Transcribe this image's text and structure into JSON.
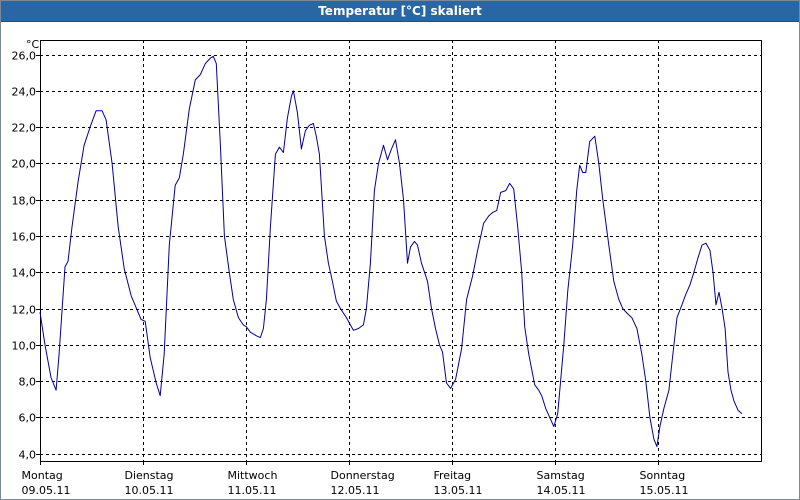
{
  "window": {
    "title": "Temperatur [°C] skaliert"
  },
  "chart_data": {
    "type": "line",
    "title": "Temperatur [°C] skaliert",
    "ylabel": "°C",
    "xlabel": "",
    "ylim": [
      3.6,
      26.8
    ],
    "yticks": [
      "4,0",
      "6,0",
      "8,0",
      "10,0",
      "12,0",
      "14,0",
      "16,0",
      "18,0",
      "20,0",
      "22,0",
      "24,0",
      "26,0"
    ],
    "ytick_values": [
      4,
      6,
      8,
      10,
      12,
      14,
      16,
      18,
      20,
      22,
      24,
      26
    ],
    "xlim": [
      0,
      7
    ],
    "x_unit": "days since Montag 09.05.11 00:00",
    "xticks": [
      {
        "day": "Montag",
        "date": "09.05.11"
      },
      {
        "day": "Dienstag",
        "date": "10.05.11"
      },
      {
        "day": "Mittwoch",
        "date": "11.05.11"
      },
      {
        "day": "Donnerstag",
        "date": "12.05.11"
      },
      {
        "day": "Freitag",
        "date": "13.05.11"
      },
      {
        "day": "Samstag",
        "date": "14.05.11"
      },
      {
        "day": "Sonntag",
        "date": "15.05.11"
      }
    ],
    "grid": true,
    "line_color": "#0000a0",
    "series": [
      {
        "points": [
          [
            0.0,
            11.8
          ],
          [
            0.049,
            10.0
          ],
          [
            0.107,
            8.2
          ],
          [
            0.156,
            7.5
          ],
          [
            0.185,
            9.5
          ],
          [
            0.243,
            14.3
          ],
          [
            0.272,
            14.6
          ],
          [
            0.311,
            16.5
          ],
          [
            0.37,
            19.0
          ],
          [
            0.428,
            21.0
          ],
          [
            0.486,
            22.0
          ],
          [
            0.545,
            22.9
          ],
          [
            0.603,
            22.9
          ],
          [
            0.642,
            22.4
          ],
          [
            0.7,
            20.0
          ],
          [
            0.759,
            16.5
          ],
          [
            0.817,
            14.2
          ],
          [
            0.885,
            12.7
          ],
          [
            0.982,
            11.4
          ],
          [
            1.021,
            11.3
          ],
          [
            1.07,
            9.3
          ],
          [
            1.128,
            7.9
          ],
          [
            1.167,
            7.2
          ],
          [
            1.206,
            9.5
          ],
          [
            1.255,
            15.5
          ],
          [
            1.313,
            18.8
          ],
          [
            1.352,
            19.2
          ],
          [
            1.391,
            20.5
          ],
          [
            1.45,
            23.0
          ],
          [
            1.508,
            24.6
          ],
          [
            1.557,
            24.9
          ],
          [
            1.605,
            25.5
          ],
          [
            1.654,
            25.8
          ],
          [
            1.683,
            25.9
          ],
          [
            1.712,
            25.5
          ],
          [
            1.751,
            21.0
          ],
          [
            1.79,
            16.0
          ],
          [
            1.838,
            14.0
          ],
          [
            1.877,
            12.5
          ],
          [
            1.926,
            11.5
          ],
          [
            1.974,
            11.1
          ],
          [
            2.003,
            11.0
          ],
          [
            2.042,
            10.7
          ],
          [
            2.101,
            10.5
          ],
          [
            2.14,
            10.4
          ],
          [
            2.169,
            10.9
          ],
          [
            2.198,
            12.5
          ],
          [
            2.237,
            16.5
          ],
          [
            2.285,
            20.5
          ],
          [
            2.324,
            20.9
          ],
          [
            2.363,
            20.6
          ],
          [
            2.402,
            22.5
          ],
          [
            2.441,
            23.7
          ],
          [
            2.46,
            24.0
          ],
          [
            2.499,
            22.8
          ],
          [
            2.538,
            20.8
          ],
          [
            2.577,
            21.8
          ],
          [
            2.615,
            22.1
          ],
          [
            2.654,
            22.2
          ],
          [
            2.683,
            21.5
          ],
          [
            2.713,
            20.5
          ],
          [
            2.761,
            16.0
          ],
          [
            2.8,
            14.5
          ],
          [
            2.839,
            13.5
          ],
          [
            2.878,
            12.4
          ],
          [
            2.917,
            12.0
          ],
          [
            2.975,
            11.5
          ],
          [
            3.004,
            11.2
          ],
          [
            3.043,
            10.8
          ],
          [
            3.092,
            10.9
          ],
          [
            3.14,
            11.1
          ],
          [
            3.169,
            12.0
          ],
          [
            3.208,
            14.5
          ],
          [
            3.247,
            18.5
          ],
          [
            3.286,
            20.0
          ],
          [
            3.335,
            21.0
          ],
          [
            3.374,
            20.2
          ],
          [
            3.413,
            20.8
          ],
          [
            3.451,
            21.3
          ],
          [
            3.49,
            20.0
          ],
          [
            3.529,
            18.0
          ],
          [
            3.568,
            14.5
          ],
          [
            3.597,
            15.4
          ],
          [
            3.636,
            15.7
          ],
          [
            3.665,
            15.5
          ],
          [
            3.704,
            14.5
          ],
          [
            3.762,
            13.5
          ],
          [
            3.801,
            12.0
          ],
          [
            3.84,
            10.9
          ],
          [
            3.879,
            10.0
          ],
          [
            3.908,
            9.6
          ],
          [
            3.947,
            7.9
          ],
          [
            3.986,
            7.6
          ],
          [
            4.035,
            8.1
          ],
          [
            4.093,
            9.8
          ],
          [
            4.142,
            12.5
          ],
          [
            4.2,
            13.8
          ],
          [
            4.249,
            15.2
          ],
          [
            4.307,
            16.7
          ],
          [
            4.356,
            17.1
          ],
          [
            4.395,
            17.3
          ],
          [
            4.434,
            17.4
          ],
          [
            4.473,
            18.4
          ],
          [
            4.521,
            18.5
          ],
          [
            4.56,
            18.9
          ],
          [
            4.599,
            18.6
          ],
          [
            4.638,
            16.5
          ],
          [
            4.677,
            14.0
          ],
          [
            4.706,
            11.0
          ],
          [
            4.745,
            9.5
          ],
          [
            4.803,
            7.8
          ],
          [
            4.842,
            7.5
          ],
          [
            4.871,
            7.2
          ],
          [
            4.91,
            6.5
          ],
          [
            4.949,
            6.0
          ],
          [
            4.988,
            5.5
          ],
          [
            5.026,
            6.2
          ],
          [
            5.085,
            10.0
          ],
          [
            5.124,
            13.0
          ],
          [
            5.172,
            15.5
          ],
          [
            5.211,
            18.5
          ],
          [
            5.24,
            19.9
          ],
          [
            5.269,
            19.5
          ],
          [
            5.299,
            19.5
          ],
          [
            5.337,
            21.2
          ],
          [
            5.386,
            21.5
          ],
          [
            5.425,
            20.0
          ],
          [
            5.464,
            18.0
          ],
          [
            5.522,
            15.5
          ],
          [
            5.571,
            13.5
          ],
          [
            5.619,
            12.5
          ],
          [
            5.658,
            12.0
          ],
          [
            5.707,
            11.7
          ],
          [
            5.746,
            11.5
          ],
          [
            5.795,
            10.9
          ],
          [
            5.843,
            9.5
          ],
          [
            5.882,
            8.0
          ],
          [
            5.921,
            6.0
          ],
          [
            5.96,
            4.8
          ],
          [
            5.989,
            4.4
          ],
          [
            6.018,
            5.5
          ],
          [
            6.057,
            6.5
          ],
          [
            6.106,
            7.5
          ],
          [
            6.135,
            9.0
          ],
          [
            6.184,
            11.5
          ],
          [
            6.232,
            12.2
          ],
          [
            6.271,
            12.8
          ],
          [
            6.31,
            13.3
          ],
          [
            6.349,
            14.0
          ],
          [
            6.388,
            14.8
          ],
          [
            6.427,
            15.5
          ],
          [
            6.466,
            15.6
          ],
          [
            6.505,
            15.2
          ],
          [
            6.534,
            14.0
          ],
          [
            6.563,
            12.2
          ],
          [
            6.592,
            12.9
          ],
          [
            6.622,
            12.0
          ],
          [
            6.651,
            10.9
          ],
          [
            6.68,
            8.5
          ],
          [
            6.709,
            7.5
          ],
          [
            6.738,
            6.9
          ],
          [
            6.777,
            6.4
          ],
          [
            6.816,
            6.2
          ]
        ]
      }
    ]
  }
}
